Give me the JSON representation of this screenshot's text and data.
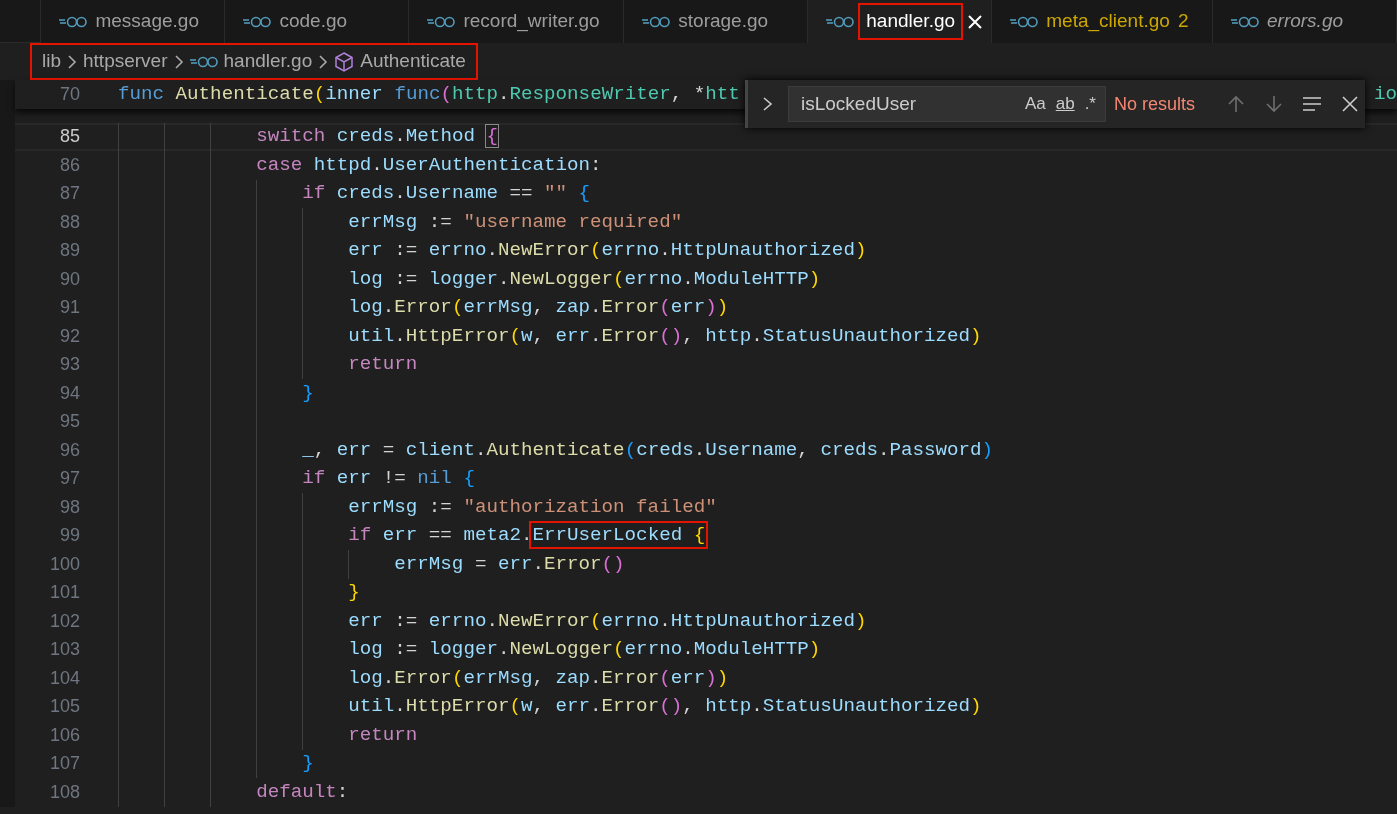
{
  "tabs": [
    {
      "label": "message.go",
      "selected": false,
      "preview": false,
      "highlighted": false
    },
    {
      "label": "code.go",
      "selected": false,
      "preview": false,
      "highlighted": false
    },
    {
      "label": "record_writer.go",
      "selected": false,
      "preview": false,
      "highlighted": false
    },
    {
      "label": "storage.go",
      "selected": false,
      "preview": false,
      "highlighted": false
    },
    {
      "label": "handler.go",
      "selected": true,
      "preview": false,
      "highlighted": true
    },
    {
      "label": "meta_client.go",
      "selected": false,
      "preview": false,
      "highlighted": false,
      "kind": "warning",
      "badge": "2"
    },
    {
      "label": "errors.go",
      "selected": false,
      "preview": true,
      "highlighted": false
    }
  ],
  "breadcrumb": {
    "highlighted": true,
    "items": [
      {
        "kind": "folder",
        "label": "lib"
      },
      {
        "kind": "folder",
        "label": "httpserver"
      },
      {
        "kind": "file",
        "label": "handler.go"
      },
      {
        "kind": "symbol",
        "label": "Authenticate"
      }
    ]
  },
  "sticky_line": {
    "number": "70",
    "tail": "io",
    "tokens": [
      {
        "kind": "kw2",
        "text": "func "
      },
      {
        "kind": "fn",
        "text": "Authenticate"
      },
      {
        "kind": "p1",
        "text": "("
      },
      {
        "kind": "var",
        "text": "inner "
      },
      {
        "kind": "kw2",
        "text": "func"
      },
      {
        "kind": "p2",
        "text": "("
      },
      {
        "kind": "type",
        "text": "http"
      },
      {
        "kind": "op",
        "text": "."
      },
      {
        "kind": "type",
        "text": "ResponseWriter"
      },
      {
        "kind": "op",
        "text": ", *"
      },
      {
        "kind": "type",
        "text": "htt"
      }
    ]
  },
  "find": {
    "value": "isLockedUser",
    "options": [
      "Aa",
      "ab",
      ".*"
    ],
    "message": "No results"
  },
  "lines": [
    {
      "number": "85",
      "current": true,
      "tokens": [
        {
          "kind": "kw",
          "text": "switch "
        },
        {
          "kind": "var",
          "text": "creds"
        },
        {
          "kind": "op",
          "text": "."
        },
        {
          "kind": "var",
          "text": "Method "
        },
        {
          "kind": "p2",
          "text": "{",
          "match": true
        }
      ]
    },
    {
      "number": "86",
      "current": false,
      "tokens": [
        {
          "kind": "kw",
          "text": "case "
        },
        {
          "kind": "var",
          "text": "httpd"
        },
        {
          "kind": "op",
          "text": "."
        },
        {
          "kind": "var",
          "text": "UserAuthentication"
        },
        {
          "kind": "op",
          "text": ":"
        }
      ],
      "children": [
        {
          "number": "87",
          "current": false,
          "tokens": [
            {
              "kind": "kw",
              "text": "if "
            },
            {
              "kind": "var",
              "text": "creds"
            },
            {
              "kind": "op",
              "text": "."
            },
            {
              "kind": "var",
              "text": "Username"
            },
            {
              "kind": "op",
              "text": " == "
            },
            {
              "kind": "str",
              "text": "\"\" "
            },
            {
              "kind": "p3",
              "text": "{"
            }
          ],
          "children": [
            {
              "number": "88",
              "current": false,
              "tokens": [
                {
                  "kind": "var",
                  "text": "errMsg"
                },
                {
                  "kind": "op",
                  "text": " := "
                },
                {
                  "kind": "str",
                  "text": "\"username required\""
                }
              ]
            },
            {
              "number": "89",
              "current": false,
              "tokens": [
                {
                  "kind": "var",
                  "text": "err"
                },
                {
                  "kind": "op",
                  "text": " := "
                },
                {
                  "kind": "var",
                  "text": "errno"
                },
                {
                  "kind": "op",
                  "text": "."
                },
                {
                  "kind": "fn",
                  "text": "NewError"
                },
                {
                  "kind": "p1",
                  "text": "("
                },
                {
                  "kind": "var",
                  "text": "errno"
                },
                {
                  "kind": "op",
                  "text": "."
                },
                {
                  "kind": "var",
                  "text": "HttpUnauthorized"
                },
                {
                  "kind": "p1",
                  "text": ")"
                }
              ]
            },
            {
              "number": "90",
              "current": false,
              "tokens": [
                {
                  "kind": "var",
                  "text": "log"
                },
                {
                  "kind": "op",
                  "text": " := "
                },
                {
                  "kind": "var",
                  "text": "logger"
                },
                {
                  "kind": "op",
                  "text": "."
                },
                {
                  "kind": "fn",
                  "text": "NewLogger"
                },
                {
                  "kind": "p1",
                  "text": "("
                },
                {
                  "kind": "var",
                  "text": "errno"
                },
                {
                  "kind": "op",
                  "text": "."
                },
                {
                  "kind": "var",
                  "text": "ModuleHTTP"
                },
                {
                  "kind": "p1",
                  "text": ")"
                }
              ]
            },
            {
              "number": "91",
              "current": false,
              "tokens": [
                {
                  "kind": "var",
                  "text": "log"
                },
                {
                  "kind": "op",
                  "text": "."
                },
                {
                  "kind": "fn",
                  "text": "Error"
                },
                {
                  "kind": "p1",
                  "text": "("
                },
                {
                  "kind": "var",
                  "text": "errMsg"
                },
                {
                  "kind": "op",
                  "text": ", "
                },
                {
                  "kind": "var",
                  "text": "zap"
                },
                {
                  "kind": "op",
                  "text": "."
                },
                {
                  "kind": "fn",
                  "text": "Error"
                },
                {
                  "kind": "p2",
                  "text": "("
                },
                {
                  "kind": "var",
                  "text": "err"
                },
                {
                  "kind": "p2",
                  "text": ")"
                },
                {
                  "kind": "p1",
                  "text": ")"
                }
              ]
            },
            {
              "number": "92",
              "current": false,
              "tokens": [
                {
                  "kind": "var",
                  "text": "util"
                },
                {
                  "kind": "op",
                  "text": "."
                },
                {
                  "kind": "fn",
                  "text": "HttpError"
                },
                {
                  "kind": "p1",
                  "text": "("
                },
                {
                  "kind": "var",
                  "text": "w"
                },
                {
                  "kind": "op",
                  "text": ", "
                },
                {
                  "kind": "var",
                  "text": "err"
                },
                {
                  "kind": "op",
                  "text": "."
                },
                {
                  "kind": "fn",
                  "text": "Error"
                },
                {
                  "kind": "p2",
                  "text": "()"
                },
                {
                  "kind": "op",
                  "text": ", "
                },
                {
                  "kind": "var",
                  "text": "http"
                },
                {
                  "kind": "op",
                  "text": "."
                },
                {
                  "kind": "var",
                  "text": "StatusUnauthorized"
                },
                {
                  "kind": "p1",
                  "text": ")"
                }
              ]
            },
            {
              "number": "93",
              "current": false,
              "tokens": [
                {
                  "kind": "kw",
                  "text": "return"
                }
              ]
            }
          ]
        },
        {
          "number": "94",
          "current": false,
          "tokens": [
            {
              "kind": "p3",
              "text": "}"
            }
          ]
        },
        {
          "number": "95",
          "current": false
        },
        {
          "number": "96",
          "current": false,
          "tokens": [
            {
              "kind": "var",
              "text": "_"
            },
            {
              "kind": "op",
              "text": ", "
            },
            {
              "kind": "var",
              "text": "err"
            },
            {
              "kind": "op",
              "text": " = "
            },
            {
              "kind": "var",
              "text": "client"
            },
            {
              "kind": "op",
              "text": "."
            },
            {
              "kind": "fn",
              "text": "Authenticate"
            },
            {
              "kind": "p3",
              "text": "("
            },
            {
              "kind": "var",
              "text": "creds"
            },
            {
              "kind": "op",
              "text": "."
            },
            {
              "kind": "var",
              "text": "Username"
            },
            {
              "kind": "op",
              "text": ", "
            },
            {
              "kind": "var",
              "text": "creds"
            },
            {
              "kind": "op",
              "text": "."
            },
            {
              "kind": "var",
              "text": "Password"
            },
            {
              "kind": "p3",
              "text": ")"
            }
          ]
        },
        {
          "number": "97",
          "current": false,
          "tokens": [
            {
              "kind": "kw",
              "text": "if "
            },
            {
              "kind": "var",
              "text": "err"
            },
            {
              "kind": "op",
              "text": " != "
            },
            {
              "kind": "kw2",
              "text": "nil "
            },
            {
              "kind": "p3",
              "text": "{"
            }
          ],
          "children": [
            {
              "number": "98",
              "current": false,
              "tokens": [
                {
                  "kind": "var",
                  "text": "errMsg"
                },
                {
                  "kind": "op",
                  "text": " := "
                },
                {
                  "kind": "str",
                  "text": "\"authorization failed\""
                }
              ]
            },
            {
              "number": "99",
              "current": false,
              "tokens": [
                {
                  "kind": "kw",
                  "text": "if "
                },
                {
                  "kind": "var",
                  "text": "err"
                },
                {
                  "kind": "op",
                  "text": " == "
                },
                {
                  "kind": "var",
                  "text": "meta2"
                },
                {
                  "kind": "op",
                  "text": "."
                },
                {
                  "kind": "var",
                  "text": "ErrUserLocked ",
                  "highlighted": true
                },
                {
                  "kind": "p1",
                  "text": "{",
                  "highlighted": true
                }
              ],
              "children": [
                {
                  "number": "100",
                  "current": false,
                  "tokens": [
                    {
                      "kind": "var",
                      "text": "errMsg"
                    },
                    {
                      "kind": "op",
                      "text": " = "
                    },
                    {
                      "kind": "var",
                      "text": "err"
                    },
                    {
                      "kind": "op",
                      "text": "."
                    },
                    {
                      "kind": "fn",
                      "text": "Error"
                    },
                    {
                      "kind": "p2",
                      "text": "()"
                    }
                  ]
                }
              ]
            },
            {
              "number": "101",
              "current": false,
              "tokens": [
                {
                  "kind": "p1",
                  "text": "}"
                }
              ]
            },
            {
              "number": "102",
              "current": false,
              "tokens": [
                {
                  "kind": "var",
                  "text": "err"
                },
                {
                  "kind": "op",
                  "text": " := "
                },
                {
                  "kind": "var",
                  "text": "errno"
                },
                {
                  "kind": "op",
                  "text": "."
                },
                {
                  "kind": "fn",
                  "text": "NewError"
                },
                {
                  "kind": "p1",
                  "text": "("
                },
                {
                  "kind": "var",
                  "text": "errno"
                },
                {
                  "kind": "op",
                  "text": "."
                },
                {
                  "kind": "var",
                  "text": "HttpUnauthorized"
                },
                {
                  "kind": "p1",
                  "text": ")"
                }
              ]
            },
            {
              "number": "103",
              "current": false,
              "tokens": [
                {
                  "kind": "var",
                  "text": "log"
                },
                {
                  "kind": "op",
                  "text": " := "
                },
                {
                  "kind": "var",
                  "text": "logger"
                },
                {
                  "kind": "op",
                  "text": "."
                },
                {
                  "kind": "fn",
                  "text": "NewLogger"
                },
                {
                  "kind": "p1",
                  "text": "("
                },
                {
                  "kind": "var",
                  "text": "errno"
                },
                {
                  "kind": "op",
                  "text": "."
                },
                {
                  "kind": "var",
                  "text": "ModuleHTTP"
                },
                {
                  "kind": "p1",
                  "text": ")"
                }
              ]
            },
            {
              "number": "104",
              "current": false,
              "tokens": [
                {
                  "kind": "var",
                  "text": "log"
                },
                {
                  "kind": "op",
                  "text": "."
                },
                {
                  "kind": "fn",
                  "text": "Error"
                },
                {
                  "kind": "p1",
                  "text": "("
                },
                {
                  "kind": "var",
                  "text": "errMsg"
                },
                {
                  "kind": "op",
                  "text": ", "
                },
                {
                  "kind": "var",
                  "text": "zap"
                },
                {
                  "kind": "op",
                  "text": "."
                },
                {
                  "kind": "fn",
                  "text": "Error"
                },
                {
                  "kind": "p2",
                  "text": "("
                },
                {
                  "kind": "var",
                  "text": "err"
                },
                {
                  "kind": "p2",
                  "text": ")"
                },
                {
                  "kind": "p1",
                  "text": ")"
                }
              ]
            },
            {
              "number": "105",
              "current": false,
              "tokens": [
                {
                  "kind": "var",
                  "text": "util"
                },
                {
                  "kind": "op",
                  "text": "."
                },
                {
                  "kind": "fn",
                  "text": "HttpError"
                },
                {
                  "kind": "p1",
                  "text": "("
                },
                {
                  "kind": "var",
                  "text": "w"
                },
                {
                  "kind": "op",
                  "text": ", "
                },
                {
                  "kind": "var",
                  "text": "err"
                },
                {
                  "kind": "op",
                  "text": "."
                },
                {
                  "kind": "fn",
                  "text": "Error"
                },
                {
                  "kind": "p2",
                  "text": "()"
                },
                {
                  "kind": "op",
                  "text": ", "
                },
                {
                  "kind": "var",
                  "text": "http"
                },
                {
                  "kind": "op",
                  "text": "."
                },
                {
                  "kind": "var",
                  "text": "StatusUnauthorized"
                },
                {
                  "kind": "p1",
                  "text": ")"
                }
              ]
            },
            {
              "number": "106",
              "current": false,
              "tokens": [
                {
                  "kind": "kw",
                  "text": "return"
                }
              ]
            }
          ]
        },
        {
          "number": "107",
          "current": false,
          "tokens": [
            {
              "kind": "p3",
              "text": "}"
            }
          ]
        }
      ]
    },
    {
      "number": "108",
      "current": false,
      "tokens": [
        {
          "kind": "kw",
          "text": "default"
        },
        {
          "kind": "op",
          "text": ":"
        }
      ]
    }
  ]
}
